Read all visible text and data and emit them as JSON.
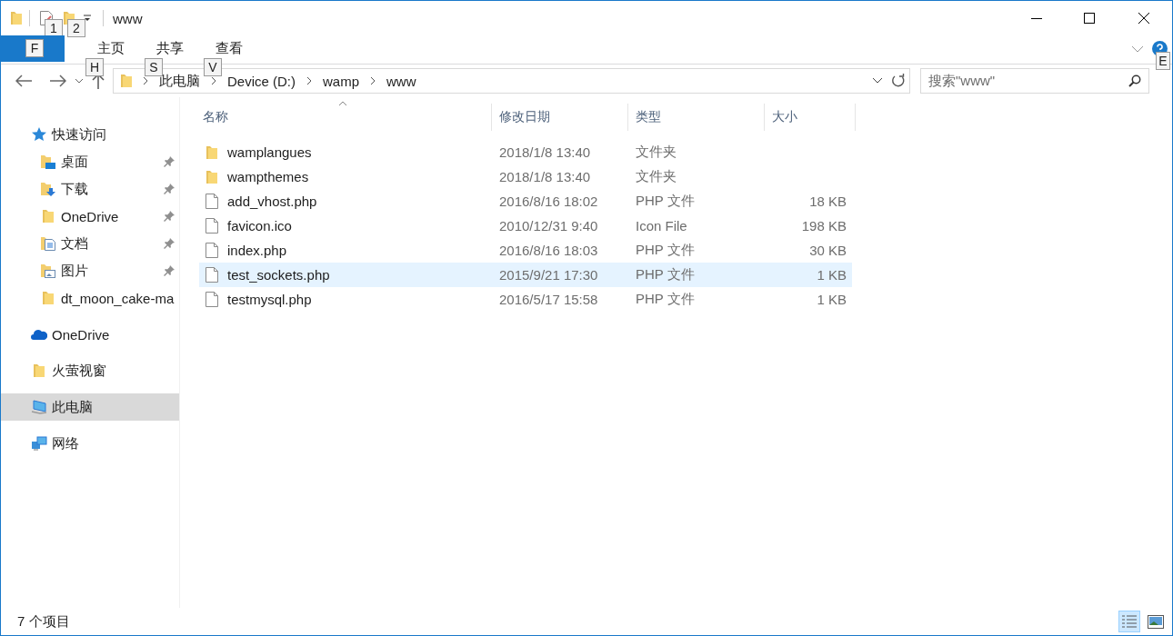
{
  "window": {
    "title": "www"
  },
  "quick_access_toolbar": {
    "key_tips": [
      "1",
      "2"
    ]
  },
  "ribbon": {
    "tabs": [
      {
        "kind": "file",
        "selected": true,
        "key_tip": "F"
      },
      {
        "label": "主页",
        "kind": "normal",
        "selected": false,
        "key_tip": "H"
      },
      {
        "label": "共享",
        "kind": "normal",
        "selected": false,
        "key_tip": "S"
      },
      {
        "label": "查看",
        "kind": "normal",
        "selected": false,
        "key_tip": "V"
      }
    ],
    "help_key_tip": "E"
  },
  "address_bar": {
    "path": [
      "此电脑",
      "Device (D:)",
      "wamp",
      "www"
    ]
  },
  "search": {
    "placeholder": "搜索\"www\""
  },
  "sidebar": {
    "items": [
      {
        "label": "快速访问",
        "kind": "star",
        "selected": false,
        "children": [
          {
            "label": "桌面",
            "kind": "desktop",
            "pinned": true,
            "selected": false
          },
          {
            "label": "下载",
            "kind": "download",
            "pinned": true,
            "selected": false
          },
          {
            "label": "OneDrive",
            "kind": "folder",
            "pinned": true,
            "selected": false
          },
          {
            "label": "文档",
            "kind": "documents",
            "pinned": true,
            "selected": false
          },
          {
            "label": "图片",
            "kind": "pictures",
            "pinned": true,
            "selected": false
          },
          {
            "label": "dt_moon_cake-ma",
            "kind": "folder",
            "pinned": false,
            "selected": false
          }
        ]
      },
      {
        "label": "OneDrive",
        "kind": "cloud",
        "selected": false
      },
      {
        "label": "火萤视窗",
        "kind": "folder",
        "selected": false
      },
      {
        "label": "此电脑",
        "kind": "computer",
        "selected": true
      },
      {
        "label": "网络",
        "kind": "network",
        "selected": false
      }
    ]
  },
  "table": {
    "columns": [
      {
        "label": "名称",
        "sorted": true
      },
      {
        "label": "修改日期",
        "sorted": false
      },
      {
        "label": "类型",
        "sorted": false
      },
      {
        "label": "大小",
        "sorted": false
      }
    ],
    "rows": [
      {
        "name": "wamplangues",
        "date": "2018/1/8 13:40",
        "type": "文件夹",
        "size": "",
        "kind": "folder",
        "hovered": false
      },
      {
        "name": "wampthemes",
        "date": "2018/1/8 13:40",
        "type": "文件夹",
        "size": "",
        "kind": "folder",
        "hovered": false
      },
      {
        "name": "add_vhost.php",
        "date": "2016/8/16 18:02",
        "type": "PHP 文件",
        "size": "18 KB",
        "kind": "file",
        "hovered": false
      },
      {
        "name": "favicon.ico",
        "date": "2010/12/31 9:40",
        "type": "Icon File",
        "size": "198 KB",
        "kind": "file",
        "hovered": false
      },
      {
        "name": "index.php",
        "date": "2016/8/16 18:03",
        "type": "PHP 文件",
        "size": "30 KB",
        "kind": "file",
        "hovered": false
      },
      {
        "name": "test_sockets.php",
        "date": "2015/9/21 17:30",
        "type": "PHP 文件",
        "size": "1 KB",
        "kind": "file",
        "hovered": true
      },
      {
        "name": "testmysql.php",
        "date": "2016/5/17 15:58",
        "type": "PHP 文件",
        "size": "1 KB",
        "kind": "file",
        "hovered": false
      }
    ]
  },
  "status_bar": {
    "item_count": "7 个项目",
    "views": [
      {
        "kind": "details",
        "selected": true
      },
      {
        "kind": "thumbnails",
        "selected": false
      }
    ]
  }
}
